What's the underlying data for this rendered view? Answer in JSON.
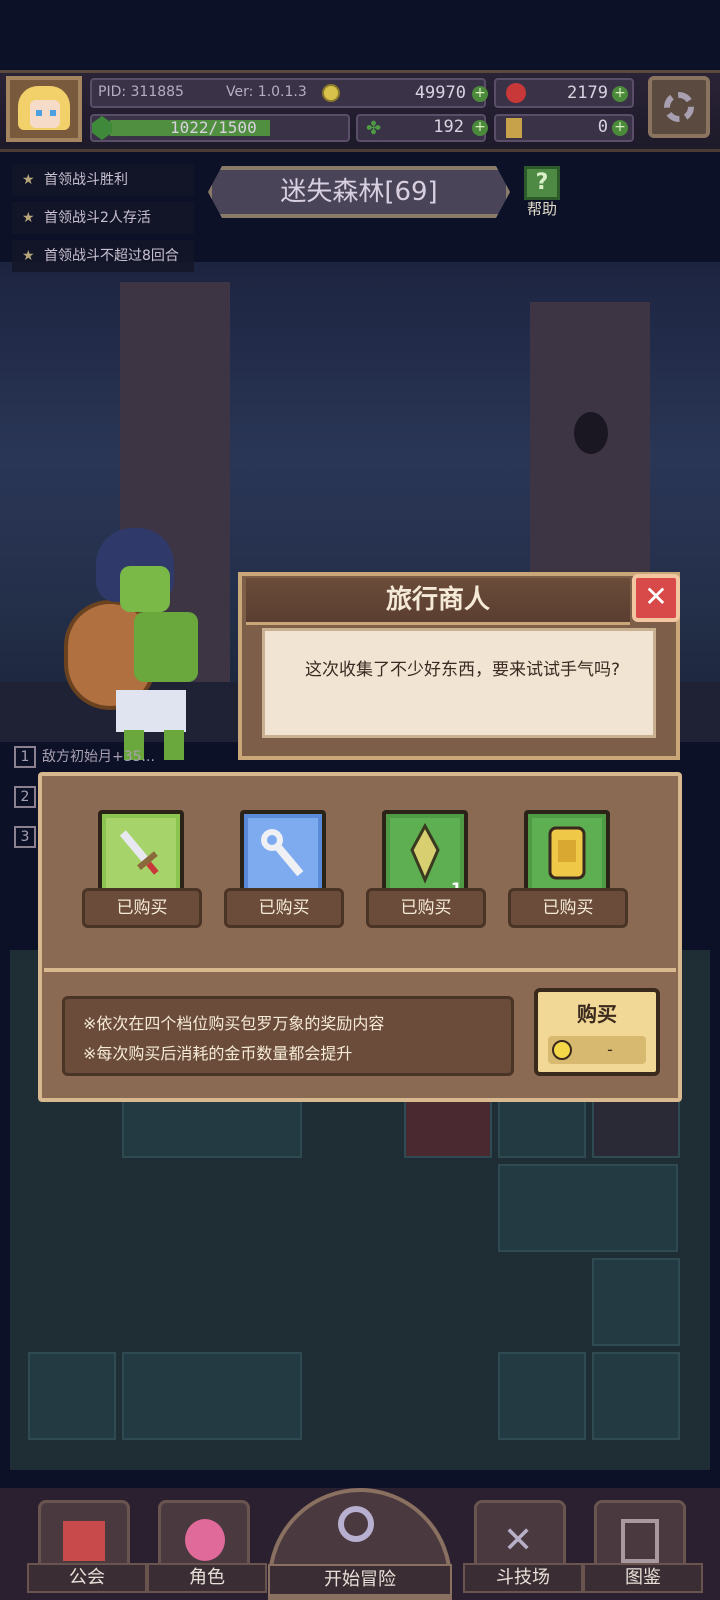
{
  "player": {
    "pid": "PID: 311885",
    "version": "Ver: 1.0.1.3",
    "xp": "1022/1500",
    "xp_fraction": 0.68,
    "gold": "49970",
    "gems": "2179",
    "clovers": "192",
    "keys": "0"
  },
  "objectives": [
    "首领战斗胜利",
    "首领战斗2人存活",
    "首领战斗不超过8回合"
  ],
  "stage": {
    "title": "迷失森林[69]",
    "help_label": "帮助"
  },
  "buffs": [
    {
      "n": "1",
      "text": "敌方初始月+35..."
    },
    {
      "n": "2",
      "text": ""
    },
    {
      "n": "3",
      "text": ""
    }
  ],
  "merchant": {
    "title": "旅行商人",
    "close_icon": "✕",
    "message": "这次收集了不少好东西，要来试试手气吗?"
  },
  "shop": {
    "slots": [
      {
        "icon": "sword-icon",
        "status": "已购买",
        "count": ""
      },
      {
        "icon": "wrench-icon",
        "status": "已购买",
        "count": ""
      },
      {
        "icon": "crystal-icon",
        "status": "已购买",
        "count": "1"
      },
      {
        "icon": "golden-tablet-icon",
        "status": "已购买",
        "count": ""
      }
    ],
    "notes": [
      "※依次在四个档位购买包罗万象的奖励内容",
      "※每次购买后消耗的金币数量都会提升"
    ],
    "buy_label": "购买",
    "buy_cost": "-"
  },
  "nav": {
    "guild": "公会",
    "character": "角色",
    "adventure": "开始冒险",
    "arena": "斗技场",
    "codex": "图鉴"
  },
  "colors": {
    "panel": "#8a6a52",
    "panel_border": "#d8b88e",
    "button": "#f2d896",
    "close": "#d84a4a"
  }
}
